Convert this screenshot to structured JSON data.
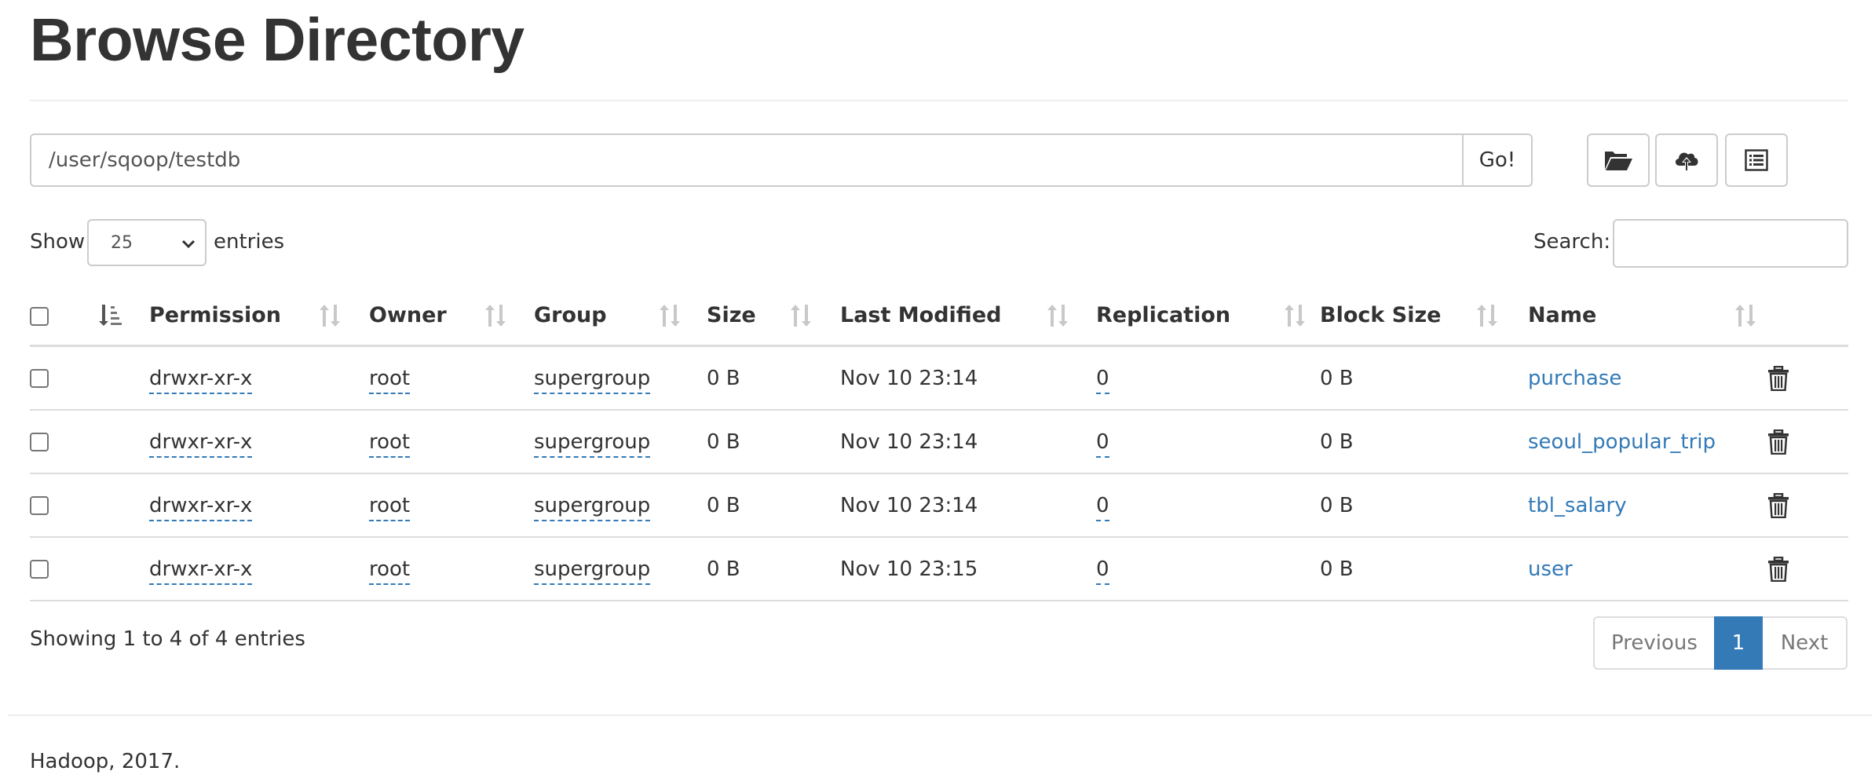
{
  "page": {
    "title": "Browse Directory"
  },
  "path_bar": {
    "path_value": "/user/sqoop/testdb",
    "go_label": "Go!"
  },
  "toolbar": {
    "icons": [
      "folder-open-icon",
      "cloud-upload-icon",
      "list-alt-icon"
    ]
  },
  "length_control": {
    "show_label": "Show",
    "selected": "25",
    "entries_label": "entries"
  },
  "search": {
    "label": "Search:",
    "value": ""
  },
  "table": {
    "columns": [
      "Permission",
      "Owner",
      "Group",
      "Size",
      "Last Modified",
      "Replication",
      "Block Size",
      "Name"
    ],
    "rows": [
      {
        "permission": "drwxr-xr-x",
        "owner": "root",
        "group": "supergroup",
        "size": "0 B",
        "last_modified": "Nov 10 23:14",
        "replication": "0",
        "block_size": "0 B",
        "name": "purchase"
      },
      {
        "permission": "drwxr-xr-x",
        "owner": "root",
        "group": "supergroup",
        "size": "0 B",
        "last_modified": "Nov 10 23:14",
        "replication": "0",
        "block_size": "0 B",
        "name": "seoul_popular_trip"
      },
      {
        "permission": "drwxr-xr-x",
        "owner": "root",
        "group": "supergroup",
        "size": "0 B",
        "last_modified": "Nov 10 23:14",
        "replication": "0",
        "block_size": "0 B",
        "name": "tbl_salary"
      },
      {
        "permission": "drwxr-xr-x",
        "owner": "root",
        "group": "supergroup",
        "size": "0 B",
        "last_modified": "Nov 10 23:15",
        "replication": "0",
        "block_size": "0 B",
        "name": "user"
      }
    ]
  },
  "info": {
    "text": "Showing 1 to 4 of 4 entries"
  },
  "pagination": {
    "previous": "Previous",
    "current": "1",
    "next": "Next"
  },
  "footer": {
    "text": "Hadoop, 2017."
  },
  "colors": {
    "link": "#337ab7",
    "active_page": "#337ab7",
    "border": "#dddddd"
  }
}
